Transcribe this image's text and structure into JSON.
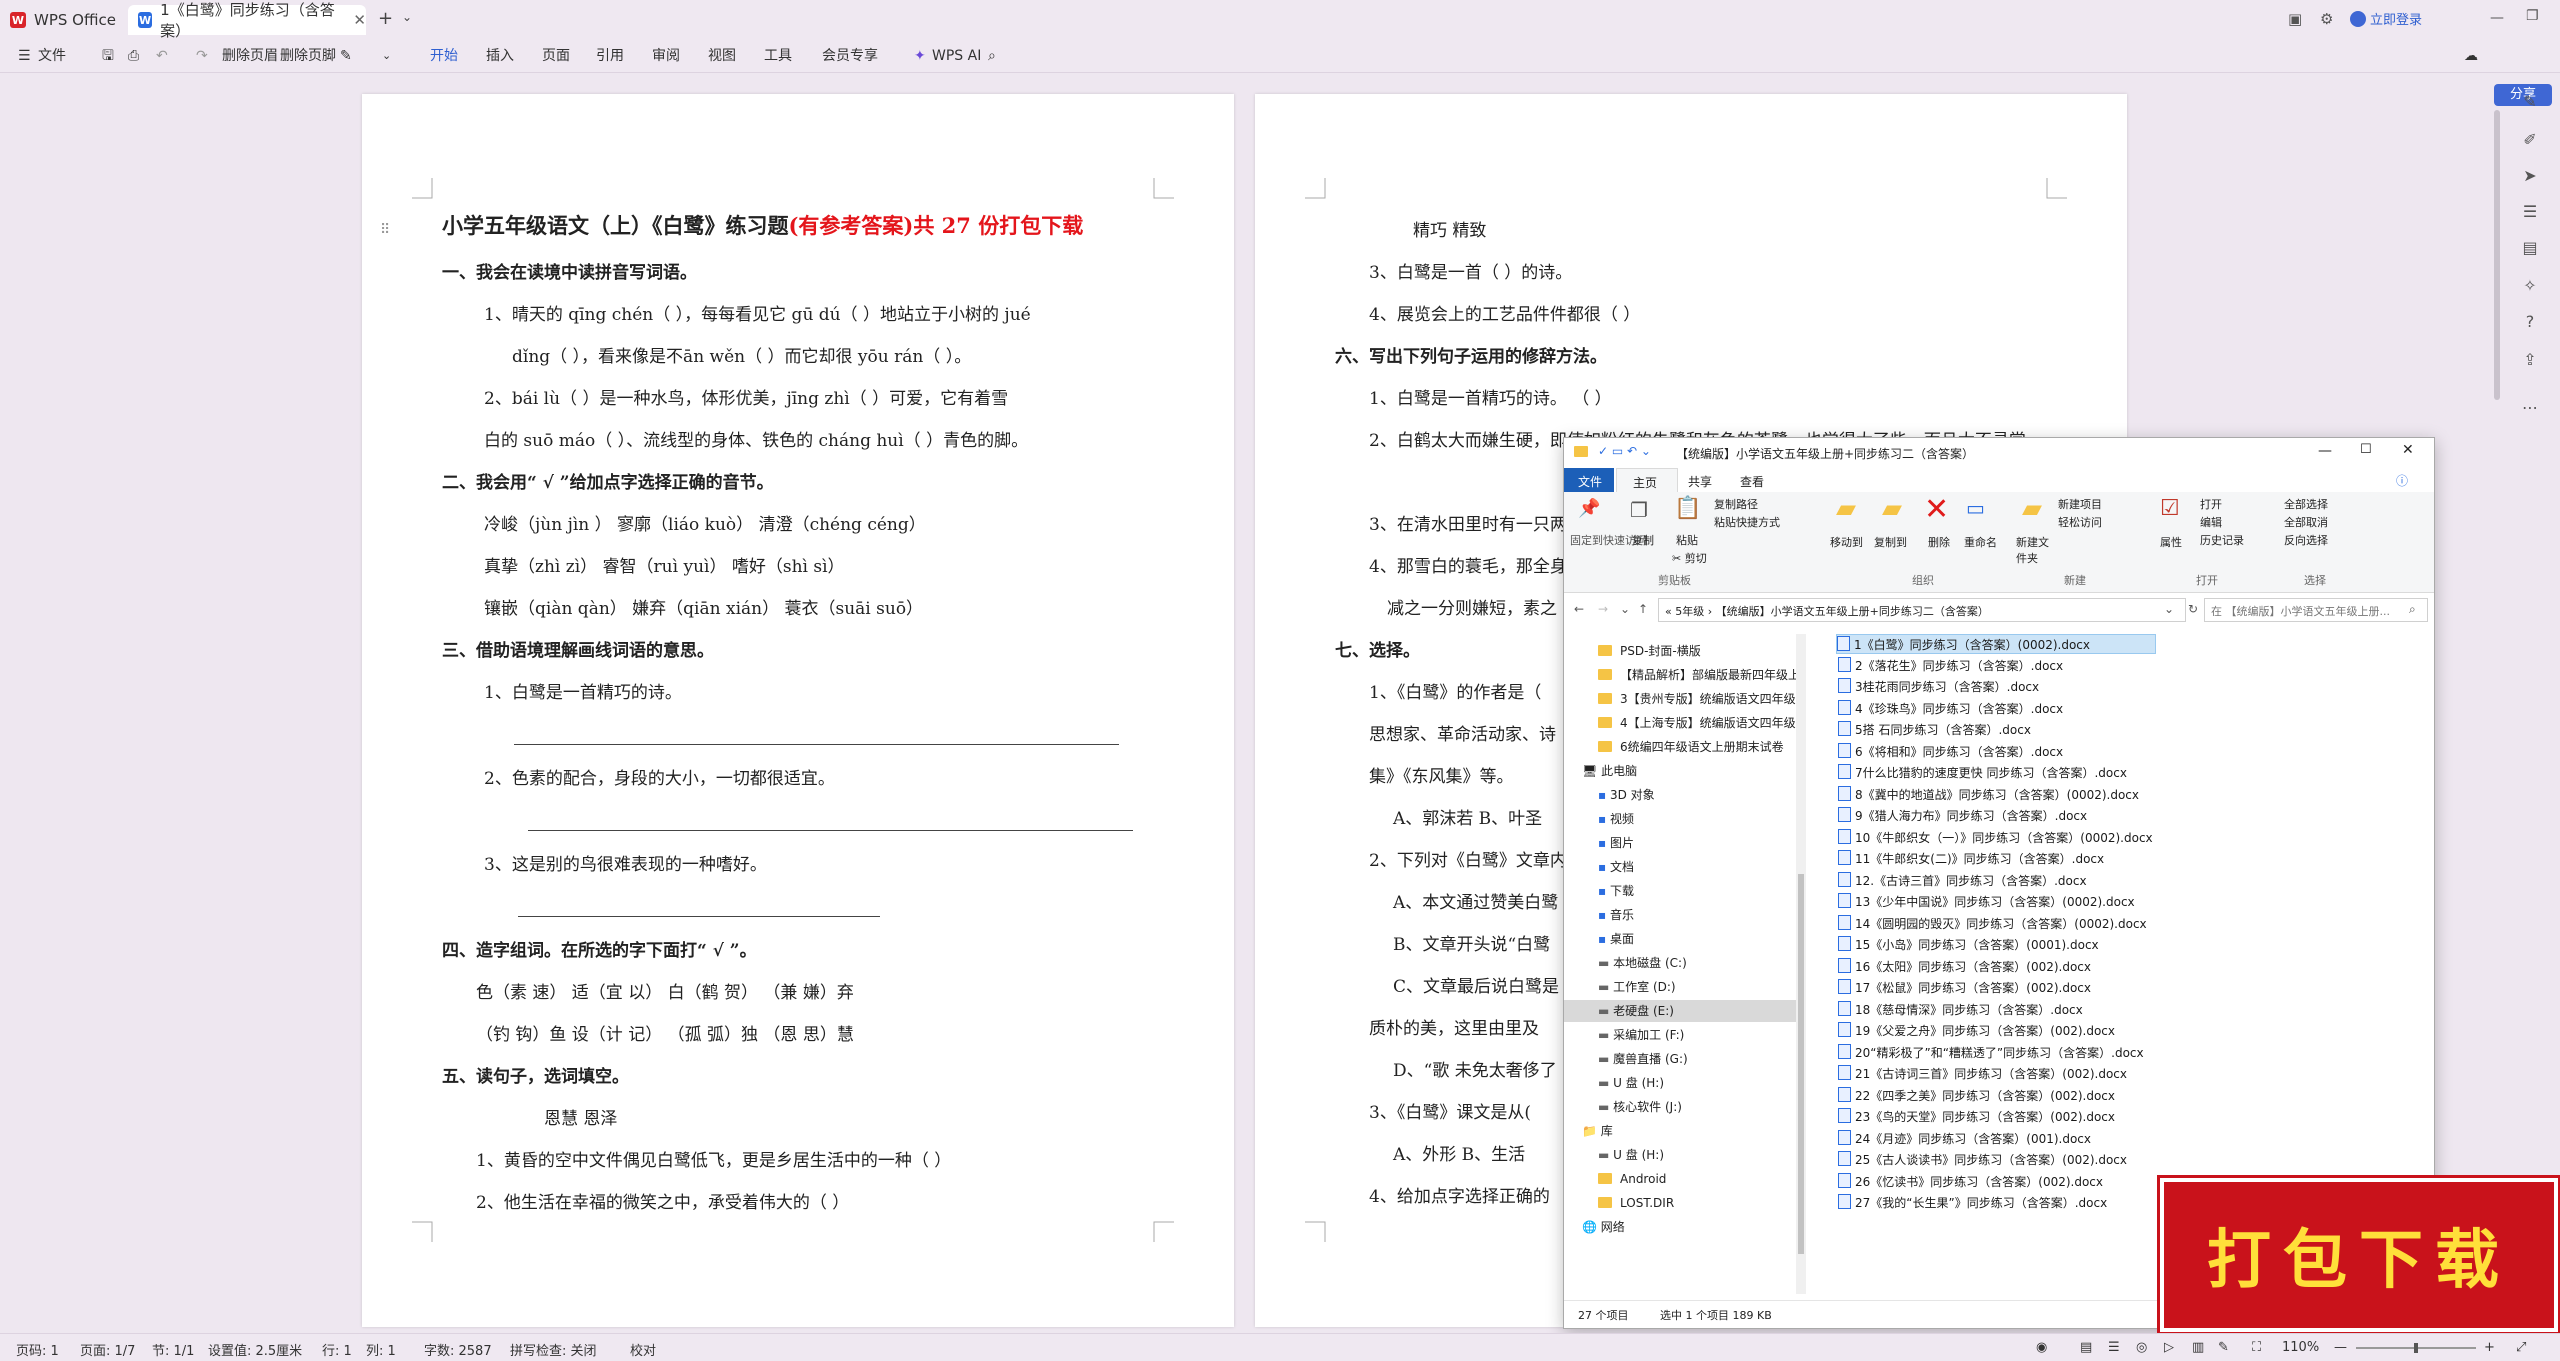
{
  "window": {
    "app_tab": "WPS Office",
    "doc_tab": "1《白鹭》同步练习（含答案）",
    "login": "立即登录",
    "share": "分享"
  },
  "ribbon": {
    "file": "文件",
    "delete_header": "删除页眉",
    "delete_footer": "删除页脚",
    "tabs": [
      "开始",
      "插入",
      "页面",
      "引用",
      "审阅",
      "视图",
      "工具",
      "会员专享"
    ],
    "wps_ai": "WPS AI"
  },
  "page1": {
    "title_black": "小学五年级语文（上）《白鹭》练习题",
    "title_red": "(有参考答案)共 27 份打包下载",
    "lines": [
      "一、我会在读境中读拼音写词语。",
      "1、晴天的 qīng  chén（        ），每每看见它 gū  dú（        ）地站立于小树的 jué",
      "dǐng（        ），看来像是不ān   wěn（          ）而它却很 yōu   rán（          ）。",
      "2、bái    lù（      ）是一种水鸟，体形优美，jīng   zhì（          ）可爱，它有着雪",
      "白的 suō   máo（        ）、流线型的身体、铁色的 cháng   huì（      ）青色的脚。",
      "二、我会用“ √ ”给加点字选择正确的音节。",
      "冷峻（jùn   jìn ）        寥廓（liáo   kuò）        清澄（chéng    céng）",
      "真挚（zhì    zì）          睿智（ruì   yuì）          嗜好（shì    sì）",
      "镶嵌（qiàn   qàn）        嫌弃（qiān   xián）        蓑衣（suāi   suō）",
      "三、借助语境理解画线词语的意思。",
      "1、白鹭是一首精巧的诗。",
      "2、色素的配合，身段的大小，一切都很适宜。",
      "3、这是别的鸟很难表现的一种嗜好。",
      "四、造字组词。在所选的字下面打“ √ ”。",
      "色（素    速）        适（宜    以）        白（鹤     贺）        （兼     嫌）弃",
      "（钓    钩）鱼        设（计    记）        （孤    弧）独          （恩     思）慧",
      "五、读句子，选词填空。",
      "恩慧      恩泽",
      "1、黄昏的空中文件偶见白鹭低飞，更是乡居生活中的一种（          ）",
      "2、他生活在幸福的微笑之中，承受着伟大的（          ）"
    ]
  },
  "page2": {
    "lines": [
      "精巧        精致",
      "3、白鹭是一首（          ）的诗。",
      "4、展览会上的工艺品件件都很（          ）",
      "六、写出下列句子运用的修辞方法。",
      "1、白鹭是一首精巧的诗。                  （              ）",
      "2、白鹤太大而嫌生硬，即使如粉红的朱鹭和灰色的苍鹭，也觉得大了些，而且太不寻常",
      "3、在清水田里时有一只两",
      "4、那雪白的蓑毛，那全身",
      "减之一分则嫌短，素之",
      "七、选择。",
      "1、《白鹭》的作者是（",
      "思想家、革命活动家、诗",
      "集》《东风集》等。",
      "A、郭沫若      B、叶圣",
      "2、下列对《白鹭》文章内",
      "A、本文通过赞美白鹭",
      "B、文章开头说“白鹭",
      "C、文章最后说白鹭是",
      "质朴的美，这里由里及",
      "D、“歌  未免太奢侈了",
      "3、《白鹭》课文是从(",
      "A、外形      B、生活",
      "4、给加点字选择正确的"
    ]
  },
  "explorer": {
    "title": "【统编版】小学语文五年级上册+同步练习二（含答案）",
    "menu_tabs": [
      "文件",
      "主页",
      "共享",
      "查看"
    ],
    "ribbon_buttons": [
      "固定到快速访问",
      "复制",
      "粘贴",
      "复制路径",
      "粘贴快捷方式",
      "剪切",
      "移动到",
      "复制到",
      "删除",
      "重命名",
      "新建文件夹",
      "新建项目",
      "轻松访问",
      "属性",
      "打开",
      "编辑",
      "历史记录",
      "全部选择",
      "全部取消",
      "反向选择"
    ],
    "ribbon_groups": [
      "剪贴板",
      "组织",
      "新建",
      "打开",
      "选择"
    ],
    "address": "« 5年级 › 【统编版】小学语文五年级上册+同步练习二（含答案）",
    "search_placeholder": "在 【统编版】小学语文五年级上册...",
    "nav": [
      "PSD-封面-横版",
      "【精品解析】部编版最新四年级上",
      "3【贵州专版】统编版语文四年级",
      "4【上海专版】统编版语文四年级",
      "6统编四年级语文上册期末试卷",
      "此电脑",
      "3D 对象",
      "视频",
      "图片",
      "文档",
      "下载",
      "音乐",
      "桌面",
      "本地磁盘 (C:)",
      "工作室 (D:)",
      "老硬盘 (E:)",
      "采编加工 (F:)",
      "魔兽直播 (G:)",
      "U 盘 (H:)",
      "核心软件 (J:)",
      "库",
      "U 盘 (H:)",
      "Android",
      "LOST.DIR",
      "网络"
    ],
    "files": [
      "1《白鹭》同步练习（含答案）(0002).docx",
      "2《落花生》同步练习（含答案）.docx",
      "3桂花雨同步练习（含答案）.docx",
      "4《珍珠鸟》同步练习（含答案）.docx",
      "5搭 石同步练习（含答案）.docx",
      "6《将相和》同步练习（含答案）.docx",
      "7什么比猎豹的速度更快 同步练习（含答案）.docx",
      "8《冀中的地道战》同步练习（含答案）(0002).docx",
      "9《猎人海力布》同步练习（含答案）.docx",
      "10《牛郎织女（一）》同步练习（含答案）(0002).docx",
      "11《牛郎织女(二)》同步练习（含答案）.docx",
      "12.《古诗三首》同步练习（含答案）.docx",
      "13《少年中国说》同步练习（含答案）(0002).docx",
      "14《圆明园的毁灭》同步练习（含答案）(0002).docx",
      "15《小岛》同步练习（含答案）(0001).docx",
      "16《太阳》同步练习（含答案）(002).docx",
      "17《松鼠》同步练习（含答案）(002).docx",
      "18《慈母情深》同步练习（含答案）.docx",
      "19《父爱之舟》同步练习（含答案）(002).docx",
      "20“精彩极了”和“糟糕透了”同步练习（含答案）.docx",
      "21《古诗词三首》同步练习（含答案）(002).docx",
      "22《四季之美》同步练习（含答案）(002).docx",
      "23《鸟的天堂》同步练习（含答案）(002).docx",
      "24《月迹》同步练习（含答案）(001).docx",
      "25《古人谈读书》同步练习（含答案）(002).docx",
      "26《忆读书》同步练习（含答案）(002).docx",
      "27《我的“长生果”》同步练习（含答案）.docx"
    ],
    "status_count": "27 个项目",
    "status_selected": "选中 1 个项目  189 KB"
  },
  "statusbar": {
    "page_code": "页码: 1",
    "pages": "页面: 1/7",
    "section": "节: 1/1",
    "setting": "设置值: 2.5厘米",
    "row": "行: 1",
    "col": "列: 1",
    "words": "字数: 2587",
    "spell": "拼写检查: 关闭",
    "proof": "校对",
    "zoom": "110%"
  },
  "stamp": {
    "text": "打包下载"
  }
}
